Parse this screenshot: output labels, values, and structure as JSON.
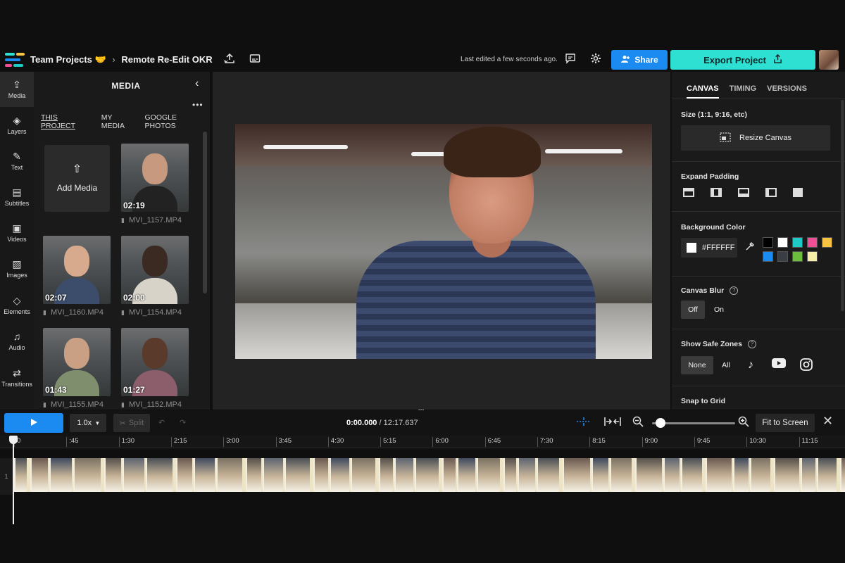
{
  "colors": {
    "accent_blue": "#1b8bf2",
    "export_teal": "#2ee0d2",
    "bg": "#0f0f0f",
    "panel": "#1a1a1a"
  },
  "topbar": {
    "workspace": "Team Projects",
    "workspace_emoji": "🤝",
    "crumb_sep": "›",
    "project": "Remote Re-Edit OKR",
    "chevron": "⌄",
    "last_edited": "Last edited a few seconds ago.",
    "share": "Share",
    "export": "Export Project",
    "icons": [
      "upload-icon",
      "captions-icon",
      "comment-icon",
      "gear-icon",
      "share-user-icon",
      "export-icon"
    ]
  },
  "rail": {
    "items": [
      {
        "label": "Media",
        "icon": "⇪"
      },
      {
        "label": "Layers",
        "icon": "◈"
      },
      {
        "label": "Text",
        "icon": "✎"
      },
      {
        "label": "Subtitles",
        "icon": "▤"
      },
      {
        "label": "Videos",
        "icon": "▣"
      },
      {
        "label": "Images",
        "icon": "▨"
      },
      {
        "label": "Elements",
        "icon": "◇"
      },
      {
        "label": "Audio",
        "icon": "♫"
      },
      {
        "label": "Transitions",
        "icon": "⇄"
      }
    ]
  },
  "media": {
    "title": "MEDIA",
    "collapse": "‹",
    "more": "•••",
    "tabs": [
      "THIS PROJECT",
      "MY MEDIA",
      "GOOGLE PHOTOS"
    ],
    "add_label": "Add Media",
    "add_icon": "⇧",
    "items": [
      {
        "duration": "02:19",
        "file": "MVI_1157.MP4"
      },
      {
        "duration": "02:07",
        "file": "MVI_1160.MP4"
      },
      {
        "duration": "02:00",
        "file": "MVI_1154.MP4"
      },
      {
        "duration": "01:43",
        "file": "MVI_1155.MP4"
      },
      {
        "duration": "01:27",
        "file": "MVI_1152.MP4"
      }
    ]
  },
  "props": {
    "tabs": [
      "CANVAS",
      "TIMING",
      "VERSIONS"
    ],
    "size_label": "Size (1:1, 9:16, etc)",
    "resize_button": "Resize Canvas",
    "expand_padding": "Expand Padding",
    "background_color": "Background Color",
    "hex_value": "#FFFFFF",
    "swatches": [
      "#000000",
      "#ffffff",
      "#1fc9c6",
      "#ef4f95",
      "#f6c342",
      "#1b8bf2",
      "#3a3d44",
      "#6cbf3c",
      "#f5f0a8"
    ],
    "canvas_blur": "Canvas Blur",
    "blur_off": "Off",
    "blur_on": "On",
    "safe_zones": "Show Safe Zones",
    "safe_none": "None",
    "safe_all": "All",
    "snap_to_grid": "Snap to Grid",
    "help": "?"
  },
  "timeline": {
    "speed": "1.0x",
    "split": "Split",
    "current_time": "0:00.000",
    "total_time": "12:17.637",
    "fit_screen": "Fit to Screen",
    "zoom_level": 0.1,
    "ticks": [
      "0",
      ":45",
      "1:30",
      "2:15",
      "3:00",
      "3:45",
      "4:30",
      "5:15",
      "6:00",
      "6:45",
      "7:30",
      "8:15",
      "9:00",
      "9:45",
      "10:30",
      "11:15"
    ],
    "track_number": "1"
  }
}
